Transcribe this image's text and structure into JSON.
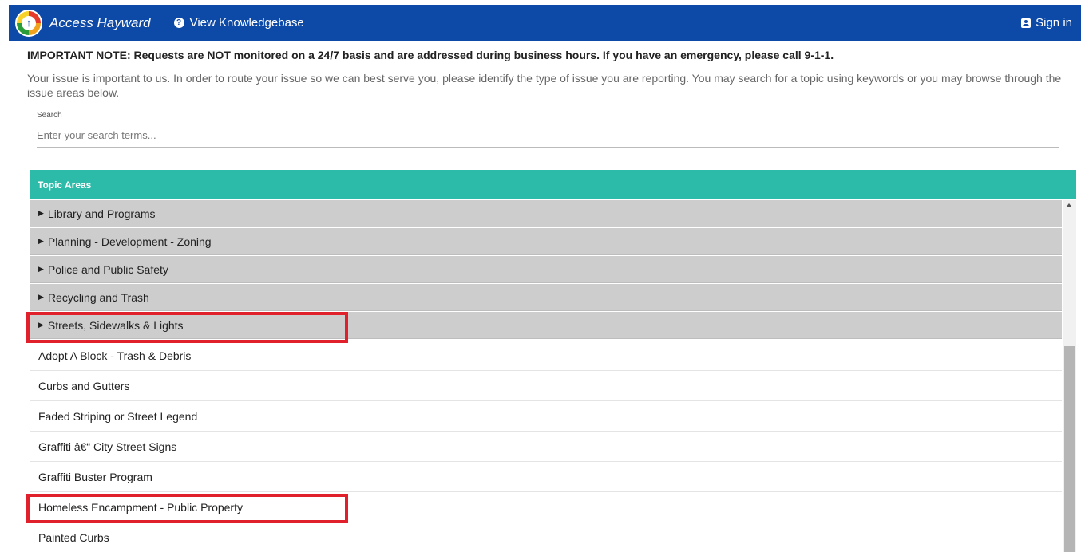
{
  "navbar": {
    "brand": "Access Hayward",
    "knowledgebase_link": "View Knowledgebase",
    "signin_label": "Sign in",
    "bg_color": "#0d4aa8"
  },
  "notice": {
    "important": "IMPORTANT NOTE: Requests are NOT monitored on a 24/7 basis and are addressed during business hours. If you have an emergency, please call 9-1-1.",
    "intro": "Your issue is important to us. In order to route your issue so we can best serve you, please identify the type of issue you are reporting. You may search for a topic using keywords or you may browse through the issue areas below."
  },
  "search": {
    "label": "Search",
    "placeholder": "Enter your search terms...",
    "value": ""
  },
  "topics": {
    "header": "Topic Areas",
    "header_color": "#2cbba8",
    "categories": [
      {
        "label": "Library and Programs",
        "expanded": false
      },
      {
        "label": "Planning - Development - Zoning",
        "expanded": false
      },
      {
        "label": "Police and Public Safety",
        "expanded": false
      },
      {
        "label": "Recycling and Trash",
        "expanded": false
      },
      {
        "label": "Streets, Sidewalks & Lights",
        "expanded": true
      }
    ],
    "items": [
      {
        "label": "Adopt A Block - Trash & Debris"
      },
      {
        "label": "Curbs and Gutters"
      },
      {
        "label": "Faded Striping or Street Legend"
      },
      {
        "label": "Graffiti â€“ City Street Signs"
      },
      {
        "label": "Graffiti Buster Program"
      },
      {
        "label": "Homeless Encampment - Public Property"
      },
      {
        "label": "Painted Curbs"
      }
    ]
  },
  "annotations": {
    "highlight_color": "#e0202a",
    "highlighted": [
      "Streets, Sidewalks & Lights",
      "Homeless Encampment - Public Property"
    ]
  }
}
